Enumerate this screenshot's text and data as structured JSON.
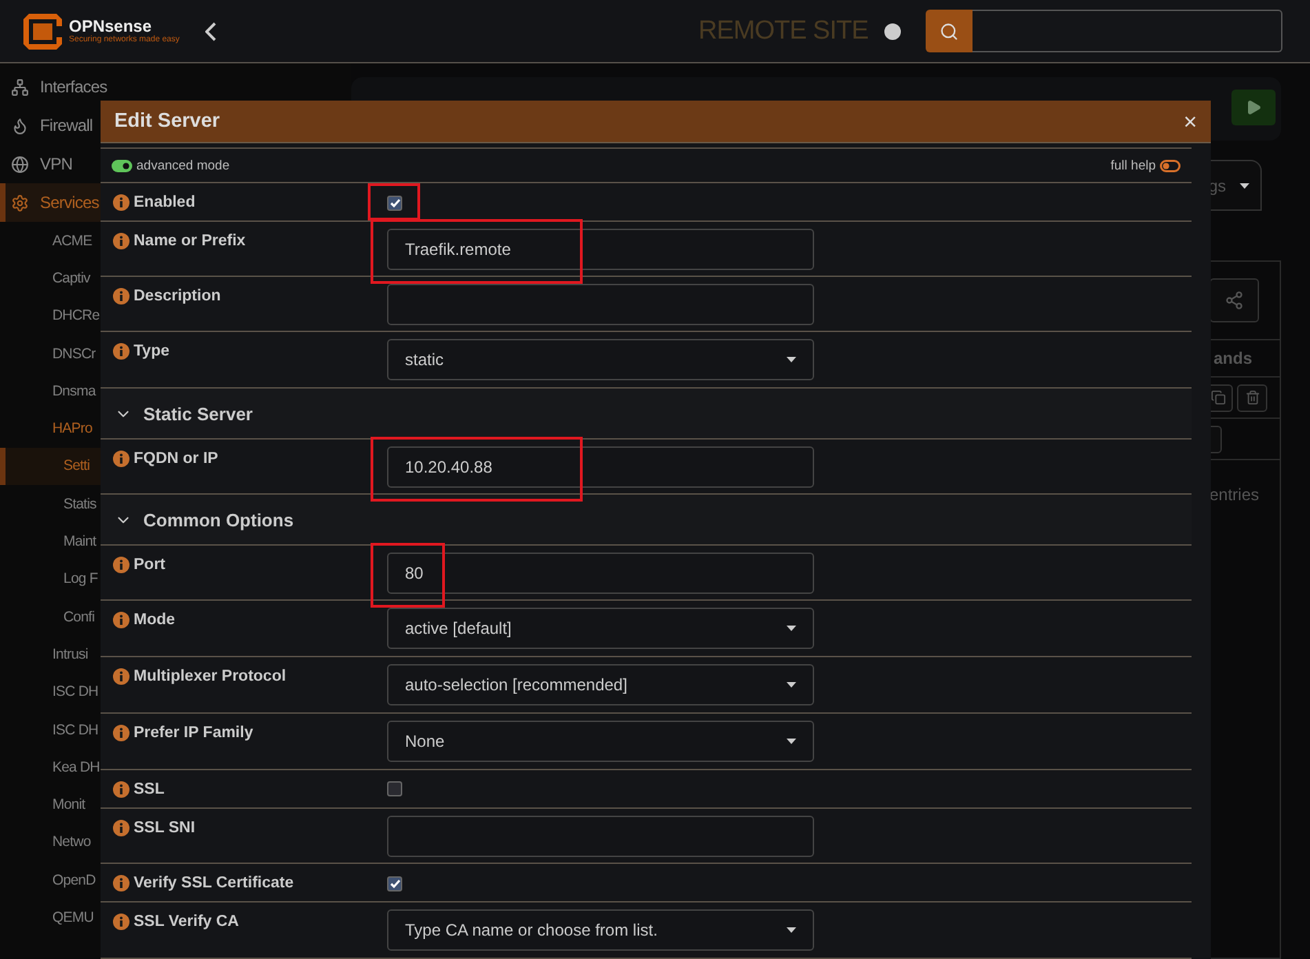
{
  "header": {
    "brand": "OPNsense",
    "tagline": "Securing networks made easy",
    "site": "REMOTE SITE"
  },
  "sidebar": {
    "items": [
      {
        "label": "Interfaces",
        "selected": false
      },
      {
        "label": "Firewall",
        "selected": false
      },
      {
        "label": "VPN",
        "selected": false
      },
      {
        "label": "Services",
        "selected": true,
        "children": [
          {
            "label": "ACME",
            "selected": false
          },
          {
            "label": "Captiv",
            "selected": false
          },
          {
            "label": "DHCRe",
            "selected": false
          },
          {
            "label": "DNSCr",
            "selected": false
          },
          {
            "label": "Dnsma",
            "selected": false
          },
          {
            "label": "HAPro",
            "selected": true,
            "children": [
              {
                "label": "Setti",
                "selected": true
              },
              {
                "label": "Statis",
                "selected": false
              },
              {
                "label": "Maint",
                "selected": false
              },
              {
                "label": "Log F",
                "selected": false
              },
              {
                "label": "Confi",
                "selected": false
              }
            ]
          },
          {
            "label": "Intrusi",
            "selected": false
          },
          {
            "label": "ISC DH",
            "selected": false
          },
          {
            "label": "ISC DH",
            "selected": false
          },
          {
            "label": "Kea DH",
            "selected": false
          },
          {
            "label": "Monit",
            "selected": false
          },
          {
            "label": "Netwo",
            "selected": false
          },
          {
            "label": "OpenD",
            "selected": false
          },
          {
            "label": "QEMU",
            "selected": false
          }
        ]
      }
    ]
  },
  "page": {
    "tab_fragment": "gs",
    "table_header_fragment": "ands",
    "footer_fragment": "entries"
  },
  "modal": {
    "title": "Edit Server",
    "close": "×",
    "advanced_mode": {
      "label": "advanced mode",
      "on": true
    },
    "full_help": {
      "label": "full help",
      "on": false
    },
    "rows": [
      {
        "kind": "checkbox",
        "label": "Enabled",
        "checked": true,
        "highlighted": true
      },
      {
        "kind": "text",
        "label": "Name or Prefix",
        "value": "Traefik.remote",
        "highlighted": true
      },
      {
        "kind": "text",
        "label": "Description",
        "highlighted": false
      },
      {
        "kind": "select",
        "label": "Type",
        "value": "static"
      },
      {
        "kind": "section",
        "label": "Static Server"
      },
      {
        "kind": "text",
        "label": "FQDN or IP",
        "value": "10.20.40.88",
        "highlighted": true
      },
      {
        "kind": "section",
        "label": "Common Options"
      },
      {
        "kind": "text",
        "label": "Port",
        "value": "80",
        "highlighted": true
      },
      {
        "kind": "select",
        "label": "Mode",
        "value": "active [default]"
      },
      {
        "kind": "select",
        "label": "Multiplexer Protocol",
        "value": "auto-selection [recommended]"
      },
      {
        "kind": "select",
        "label": "Prefer IP Family",
        "value": "None"
      },
      {
        "kind": "checkbox",
        "label": "SSL",
        "checked": false,
        "highlighted": false
      },
      {
        "kind": "text",
        "label": "SSL SNI",
        "highlighted": false
      },
      {
        "kind": "checkbox",
        "label": "Verify SSL Certificate",
        "checked": true,
        "highlighted": false
      },
      {
        "kind": "select",
        "label": "SSL Verify CA",
        "placeholder": "Type CA name or choose from list."
      }
    ]
  }
}
